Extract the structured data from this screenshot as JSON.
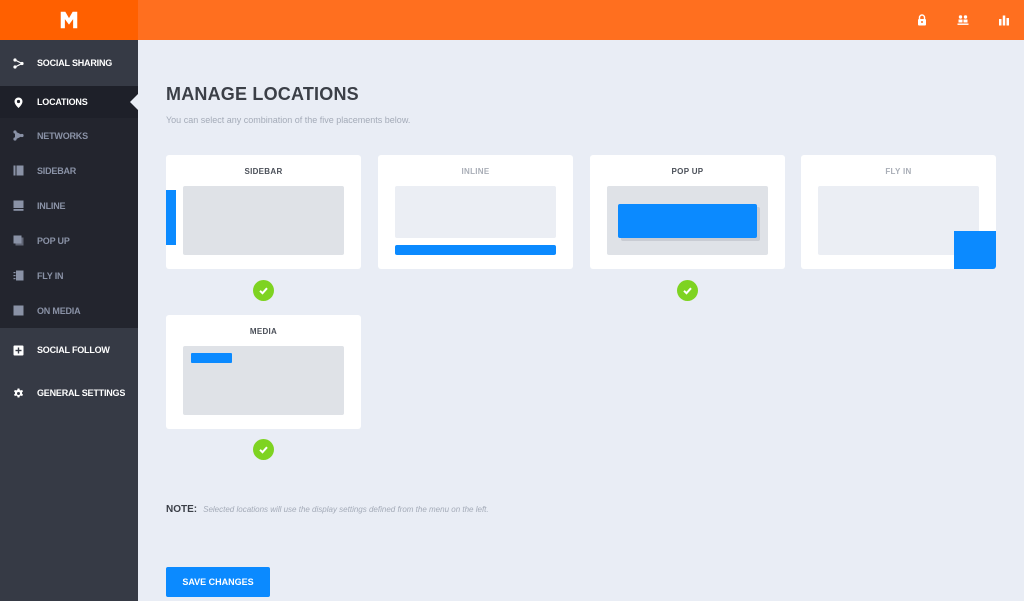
{
  "brand": {
    "logo_letter": "M",
    "accent": "#ff6f1f",
    "logo_bg": "#ff6000"
  },
  "header": {
    "icons": [
      {
        "name": "lock-icon"
      },
      {
        "name": "users-icon"
      },
      {
        "name": "bar-chart-icon"
      }
    ]
  },
  "sidebar": {
    "items": [
      {
        "label": "SOCIAL SHARING",
        "icon": "share-icon",
        "active": false
      },
      {
        "label": "LOCATIONS",
        "icon": "map-pin-icon",
        "active": true
      },
      {
        "label": "NETWORKS",
        "icon": "share-icon",
        "sub": true
      },
      {
        "label": "SIDEBAR",
        "icon": "sidebar-layout-icon",
        "sub": true
      },
      {
        "label": "INLINE",
        "icon": "inline-layout-icon",
        "sub": true
      },
      {
        "label": "POP UP",
        "icon": "popup-layout-icon",
        "sub": true
      },
      {
        "label": "FLY IN",
        "icon": "flyin-layout-icon",
        "sub": true
      },
      {
        "label": "ON MEDIA",
        "icon": "image-icon",
        "sub": true
      },
      {
        "label": "SOCIAL FOLLOW",
        "icon": "plus-square-icon",
        "active": false
      },
      {
        "label": "GENERAL SETTINGS",
        "icon": "gear-icon",
        "active": false
      }
    ]
  },
  "main": {
    "title": "MANAGE LOCATIONS",
    "subtitle": "You can select any combination of the five placements below.",
    "locations": [
      {
        "label": "SIDEBAR",
        "selected": true
      },
      {
        "label": "INLINE",
        "selected": false
      },
      {
        "label": "POP UP",
        "selected": true
      },
      {
        "label": "FLY IN",
        "selected": false
      },
      {
        "label": "MEDIA",
        "selected": true
      }
    ],
    "note_label": "NOTE:",
    "note_text": "Selected locations will use the display settings defined from the menu on the left.",
    "save_label": "SAVE CHANGES"
  },
  "colors": {
    "primary_blue": "#0b8aff",
    "check_green": "#7ed321",
    "sidebar_bg": "#363a45",
    "content_bg": "#e9edf5"
  }
}
